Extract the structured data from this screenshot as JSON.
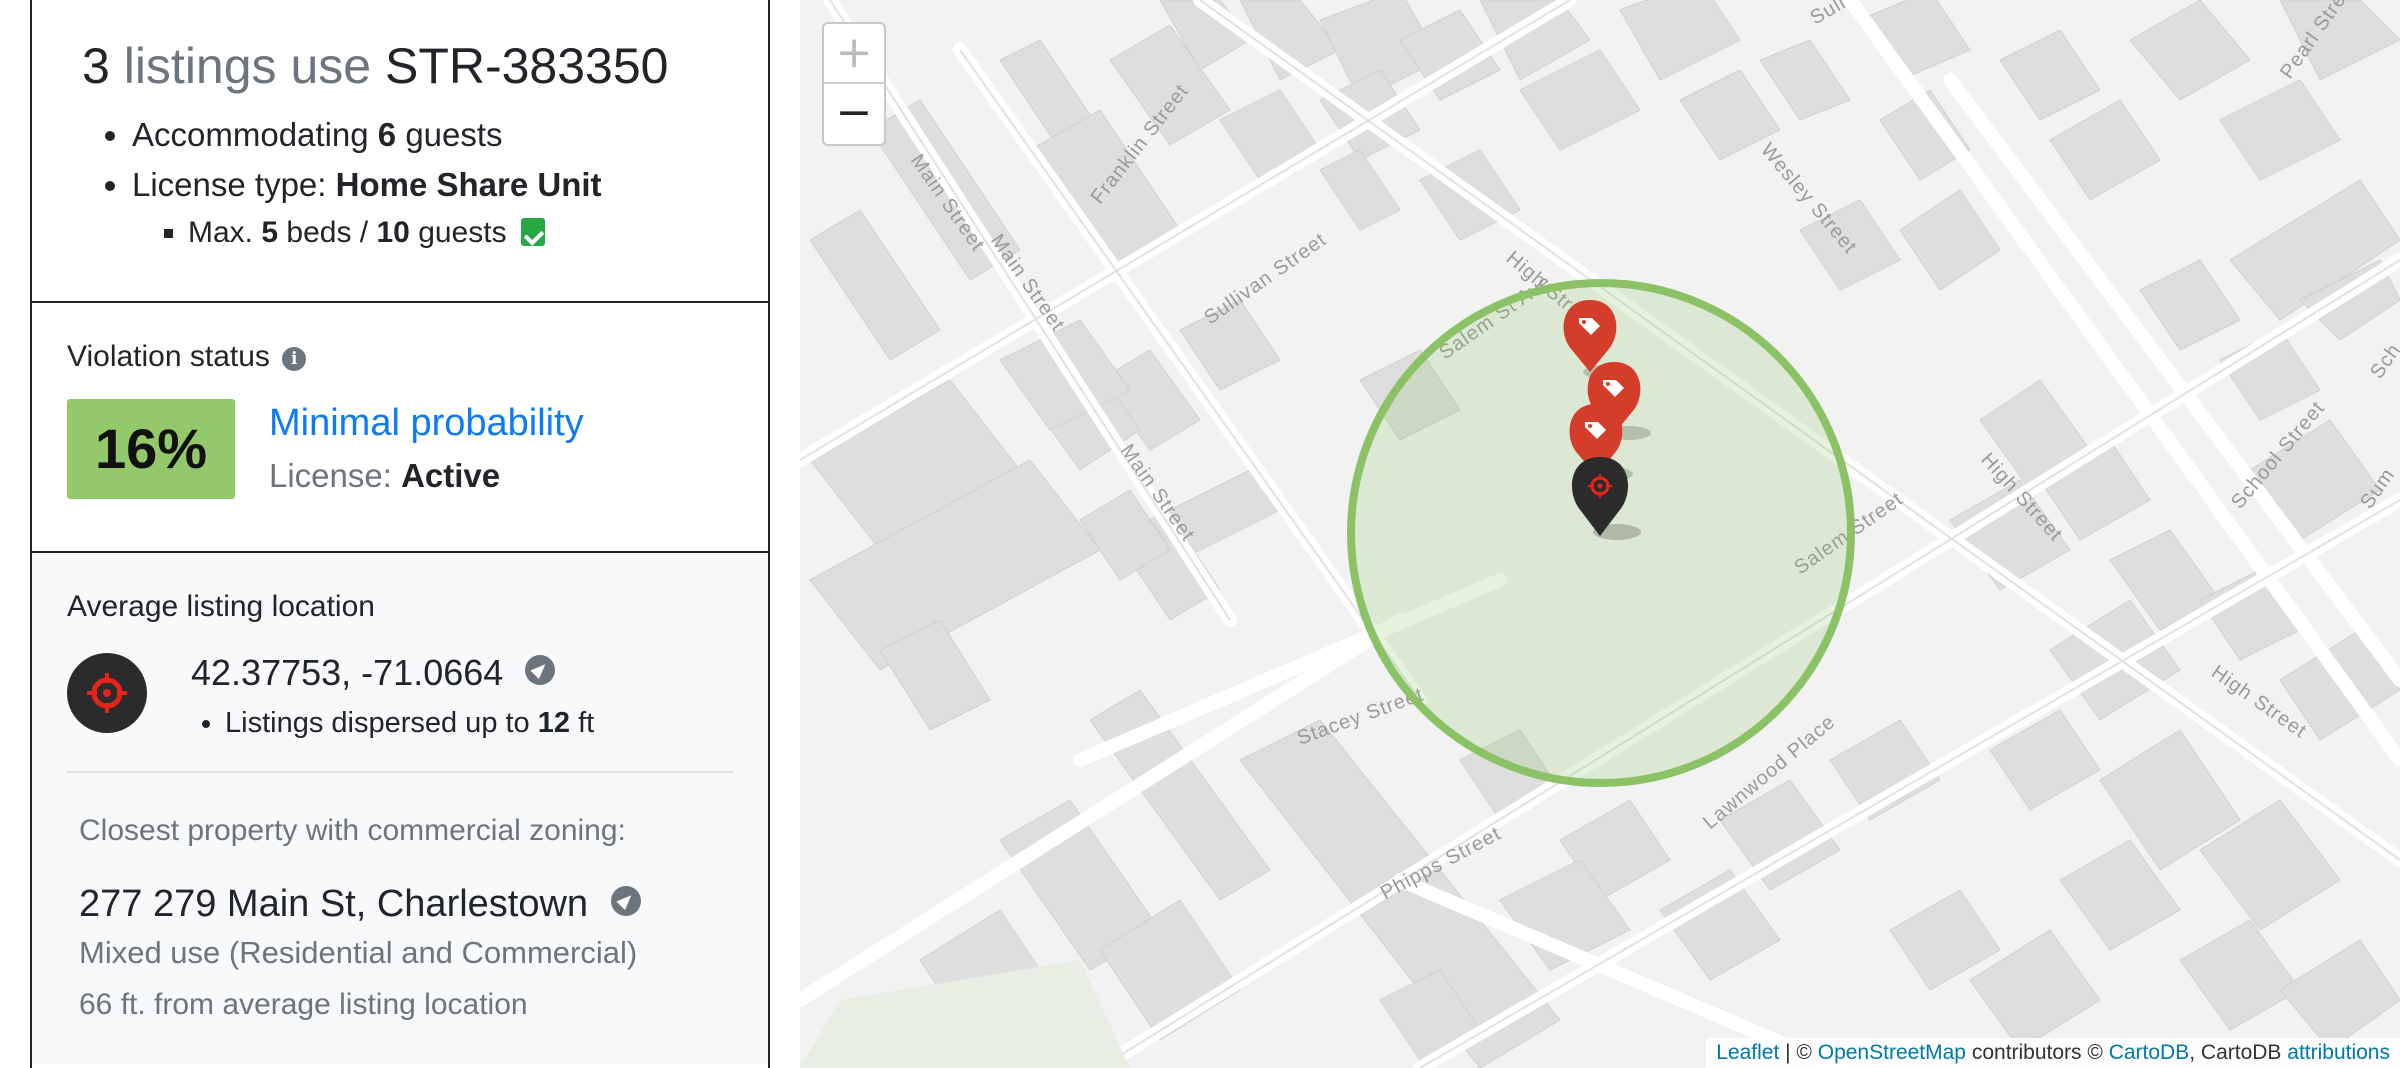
{
  "summary": {
    "count": "3",
    "listings_use": "listings use",
    "license_id": "STR-383350",
    "accommodating_prefix": "Accommodating",
    "guests_count": "6",
    "guests_suffix": "guests",
    "license_type_prefix": "License type:",
    "license_type": "Home Share Unit",
    "max_prefix": "Max.",
    "max_beds": "5",
    "beds_mid": "beds /",
    "max_guests": "10",
    "max_guests_suffix": "guests"
  },
  "violation": {
    "label": "Violation status",
    "percent": "16%",
    "probability": "Minimal probability",
    "license_prefix": "License:",
    "license_status": "Active",
    "percent_color": "#93c96b",
    "probability_color": "#0d7bf5"
  },
  "location": {
    "label": "Average listing location",
    "coords": "42.37753, -71.0664",
    "dispersed_prefix": "Listings dispersed up to",
    "dispersed_value": "12",
    "dispersed_unit": "ft"
  },
  "closest": {
    "label": "Closest property with commercial zoning:",
    "address": "277 279 Main St, Charlestown",
    "zoning": "Mixed use (Residential and Commercial)",
    "distance": "66 ft. from average listing location"
  },
  "map": {
    "zoom_in": "+",
    "zoom_out": "−",
    "streets": [
      "Main Street",
      "Main Street",
      "Main Street",
      "Franklin Street",
      "Sullivan Street",
      "Salem St Ave",
      "High Street",
      "Wesley Street",
      "Salem Street",
      "Stacey Street",
      "Phipps Street",
      "Lawnwood Place",
      "High Street",
      "High Street",
      "School Street",
      "Pearl Street",
      "Sull",
      "Sum",
      "Sch"
    ],
    "marker_color": "#d33d29",
    "center_marker_color": "#2b2b2b",
    "radius_color": "#8cc266",
    "attribution": {
      "leaflet": "Leaflet",
      "sep": " | © ",
      "osm": "OpenStreetMap",
      "contrib": " contributors © ",
      "carto": "CartoDB",
      "carto2": ", CartoDB ",
      "attributions": "attributions"
    }
  }
}
